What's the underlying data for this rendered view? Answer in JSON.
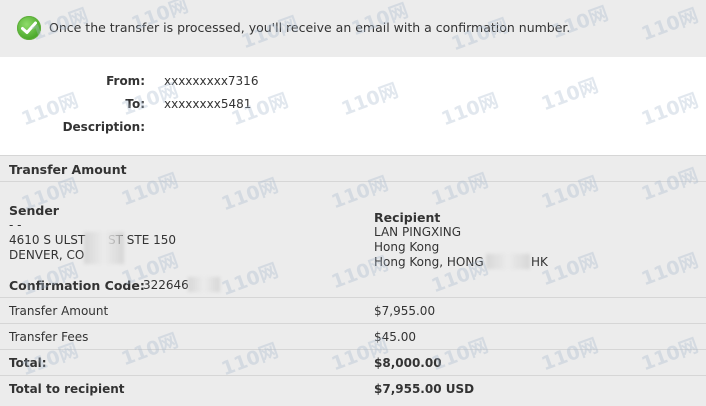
{
  "notice": {
    "message": "Once the transfer is processed, you'll receive an email with a confirmation number."
  },
  "details": {
    "from_label": "From:",
    "from_value": "xxxxxxxxx7316",
    "to_label": "To:",
    "to_value": "xxxxxxxx5481",
    "description_label": "Description:",
    "description_value": ""
  },
  "transfer_amount_header": "Transfer Amount",
  "sender": {
    "title": "Sender",
    "line1": "- -",
    "line2": "4610 S ULST",
    "line2b": "ST STE 150",
    "line3": "DENVER, CO"
  },
  "recipient": {
    "title": "Recipient",
    "line1": "LAN PINGXING",
    "line2": "Hong Kong",
    "line3a": "Hong Kong, HONG",
    "line3b": "HK"
  },
  "confirmation": {
    "label": "Confirmation Code:",
    "value": "322646"
  },
  "summary": [
    {
      "label": "Transfer Amount",
      "value": "$7,955.00"
    },
    {
      "label": "Transfer Fees",
      "value": "$45.00"
    },
    {
      "label": "Total:",
      "value": "$8,000.00"
    },
    {
      "label": "Total to recipient",
      "value": "$7,955.00 USD"
    }
  ],
  "watermark": "110网",
  "colors": {
    "panel": "#ececec",
    "success": "#4aa82a"
  }
}
